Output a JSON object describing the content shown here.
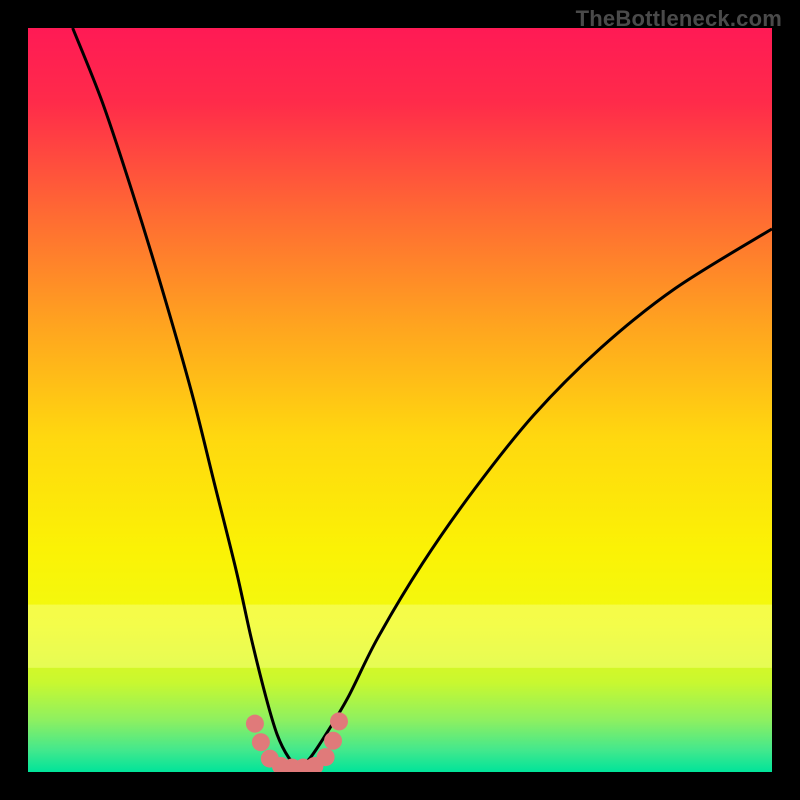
{
  "watermark": "TheBottleneck.com",
  "chart_data": {
    "type": "line",
    "title": "",
    "xlabel": "",
    "ylabel": "",
    "xlim": [
      0,
      100
    ],
    "ylim": [
      0,
      100
    ],
    "grid": false,
    "legend": false,
    "series": [
      {
        "name": "left-branch",
        "x": [
          6,
          10,
          14,
          18,
          22,
          25,
          28,
          30,
          32,
          33.5,
          35,
          36.5
        ],
        "y": [
          100,
          90,
          78,
          65,
          51,
          39,
          27,
          18,
          10,
          5,
          2,
          0.5
        ]
      },
      {
        "name": "right-branch",
        "x": [
          36.5,
          38,
          40,
          43,
          47,
          53,
          60,
          68,
          77,
          87,
          100
        ],
        "y": [
          0.5,
          2,
          5,
          10,
          18,
          28,
          38,
          48,
          57,
          65,
          73
        ]
      },
      {
        "name": "marker-cluster",
        "type": "scatter",
        "points": [
          {
            "x": 30.5,
            "y": 6.5
          },
          {
            "x": 31.3,
            "y": 4.0
          },
          {
            "x": 32.5,
            "y": 1.8
          },
          {
            "x": 34.0,
            "y": 0.8
          },
          {
            "x": 35.5,
            "y": 0.6
          },
          {
            "x": 37.0,
            "y": 0.6
          },
          {
            "x": 38.5,
            "y": 0.8
          },
          {
            "x": 40.0,
            "y": 2.0
          },
          {
            "x": 41.0,
            "y": 4.2
          },
          {
            "x": 41.8,
            "y": 6.8
          }
        ]
      }
    ],
    "gradient_stops": [
      {
        "pos": 0.0,
        "color": "#ff1a55"
      },
      {
        "pos": 0.1,
        "color": "#ff2b4a"
      },
      {
        "pos": 0.25,
        "color": "#ff6a33"
      },
      {
        "pos": 0.4,
        "color": "#ffa41f"
      },
      {
        "pos": 0.55,
        "color": "#ffd80f"
      },
      {
        "pos": 0.7,
        "color": "#fbf205"
      },
      {
        "pos": 0.8,
        "color": "#f2fa10"
      },
      {
        "pos": 0.88,
        "color": "#c8f830"
      },
      {
        "pos": 0.93,
        "color": "#8ef060"
      },
      {
        "pos": 0.97,
        "color": "#44e88c"
      },
      {
        "pos": 1.0,
        "color": "#00e49a"
      }
    ],
    "colors": {
      "curve": "#000000",
      "marker": "#e07a7a",
      "bright_band": "#f6ff7a"
    }
  }
}
